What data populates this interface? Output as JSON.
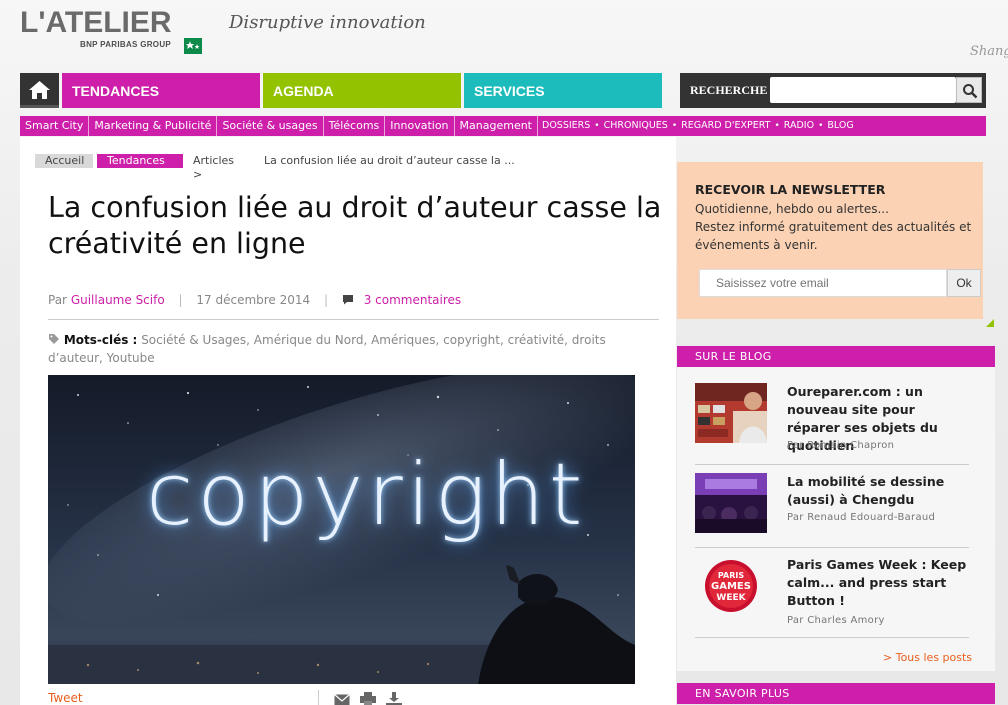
{
  "header": {
    "logo_text": "L'ATELIER",
    "logo_sub": "BNP PARIBAS GROUP",
    "tagline": "Disruptive innovation",
    "map_label": "Shang"
  },
  "nav": {
    "tabs": [
      {
        "label": "TENDANCES",
        "color": "#cd1fa9"
      },
      {
        "label": "AGENDA",
        "color": "#92c200"
      },
      {
        "label": "SERVICES",
        "color": "#1dbcbc"
      }
    ],
    "search_label": "RECHERCHE",
    "search_value": ""
  },
  "subnav": {
    "items": [
      "Smart City",
      "Marketing & Publicité",
      "Société & usages",
      "Télécoms",
      "Innovation",
      "Management"
    ],
    "caps_items": [
      "DOSSIERS",
      "CHRONIQUES",
      "REGARD D'EXPERT",
      "RADIO",
      "BLOG"
    ],
    "bullet": "•"
  },
  "breadcrumb": {
    "items": [
      "Accueil",
      "Tendances",
      "Articles  >",
      "La confusion liée au droit d’auteur casse la ..."
    ]
  },
  "article": {
    "title": "La confusion liée au droit d’auteur casse la créativité en ligne",
    "by": "Par",
    "author": "Guillaume Scifo",
    "date": "17 décembre 2014",
    "comments": "3 commentaires",
    "tags_label": "Mots-clés :",
    "tags": "Société & Usages, Amérique du Nord, Amériques, copyright, créativité, droits d’auteur, Youtube",
    "hero_word": "copyright",
    "tweet": "Tweet"
  },
  "newsletter": {
    "title": "RECEVOIR LA NEWSLETTER",
    "text_line1": "Quotidienne, hebdo ou alertes...",
    "text_line2": "Restez informé gratuitement des actualités et événements à venir.",
    "placeholder": "Saisissez votre email",
    "ok": "Ok"
  },
  "blog": {
    "header": "SUR LE BLOG",
    "posts": [
      {
        "title": "Oureparer.com : un nouveau site pour réparer ses objets du quotidien",
        "by": "Par Romain Chapron"
      },
      {
        "title": "La mobilité se dessine (aussi) à Chengdu",
        "by": "Par Renaud Edouard-Baraud"
      },
      {
        "title": "Paris Games Week : Keep calm... and press start Button !",
        "by": "Par Charles Amory"
      }
    ],
    "pgw_logo_text": [
      "PARIS",
      "GAMES",
      "WEEK"
    ],
    "all_posts": "> Tous les posts",
    "more_header": "EN SAVOIR PLUS"
  },
  "colors": {
    "brand_magenta": "#cd1fa9",
    "brand_green": "#92c200",
    "brand_teal": "#1dbcbc",
    "accent_orange": "#e8601e",
    "newsletter_bg": "#fbd2b4"
  },
  "icons": {
    "home": "home-icon",
    "search": "search-icon",
    "comment": "comment-icon",
    "tag": "tag-icon",
    "mail": "mail-icon",
    "print": "print-icon",
    "download": "download-icon"
  }
}
